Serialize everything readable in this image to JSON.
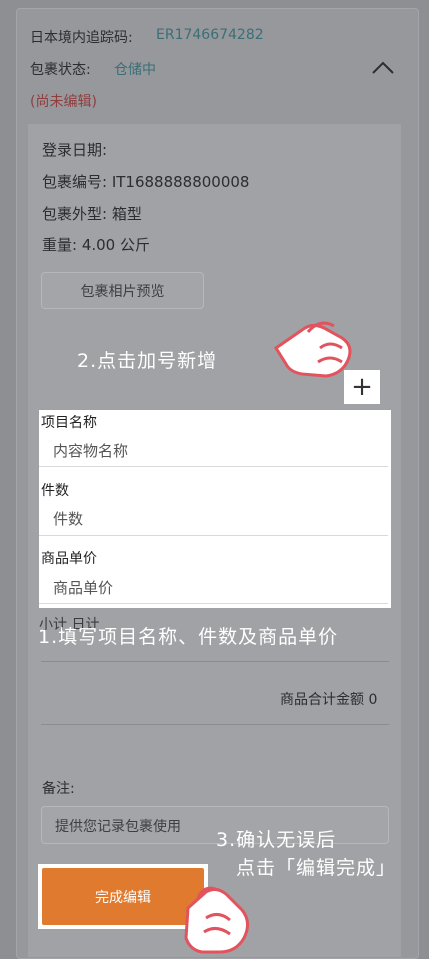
{
  "package": {
    "tracking_label": "日本境内追踪码:",
    "tracking_value": "ER1746674282",
    "status_label": "包裹状态:",
    "status_value": "仓储中",
    "edit_state": "(尚未编辑)",
    "login_date_label": "登录日期:",
    "package_no": "包裹编号: IT1688888800008",
    "package_type": "包裹外型: 箱型",
    "weight": "重量: 4.00 公斤",
    "photo_button": "包裹相片预览"
  },
  "guide": {
    "step2": "2.点击加号新增",
    "step1": "1.填写项目名称、件数及商品单价",
    "step3_line1": "3.确认无误后",
    "step3_line2": "点击「编辑完成」"
  },
  "form": {
    "item_name_label": "项目名称",
    "item_name_placeholder": "内容物名称",
    "qty_label": "件数",
    "qty_placeholder": "件数",
    "price_label": "商品单价",
    "price_placeholder": "商品单价",
    "plus_symbol": "+"
  },
  "summary": {
    "subtotal_partial": "小计 日计",
    "total_label": "商品合计金额 0"
  },
  "note": {
    "label": "备注:",
    "placeholder": "提供您记录包裹使用"
  },
  "actions": {
    "finish_label": "完成编辑"
  },
  "colors": {
    "teal": "#3a6f77",
    "warning": "#8f3e3e",
    "accent": "#df7a2e",
    "hand": "#e2535e"
  },
  "icons": {
    "collapse": "chevron-up-icon",
    "pointer": "pointing-hand-icon"
  }
}
